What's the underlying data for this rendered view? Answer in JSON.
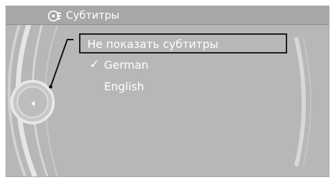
{
  "header": {
    "title": "Субтитры",
    "icon": "subtitles-icon"
  },
  "menu": {
    "items": [
      {
        "label": "Не показать субтитры",
        "selected": true,
        "checked": false
      },
      {
        "label": "German",
        "selected": false,
        "checked": true,
        "check_mark": "✓"
      },
      {
        "label": "English",
        "selected": false,
        "checked": false
      }
    ]
  },
  "controller": {
    "icon": "controller-left-arrow-icon"
  },
  "colors": {
    "background": "#b7b7b7",
    "title_bar": "#a7a7a7",
    "text": "#ffffff",
    "highlight_border": "#1a1a1a"
  }
}
